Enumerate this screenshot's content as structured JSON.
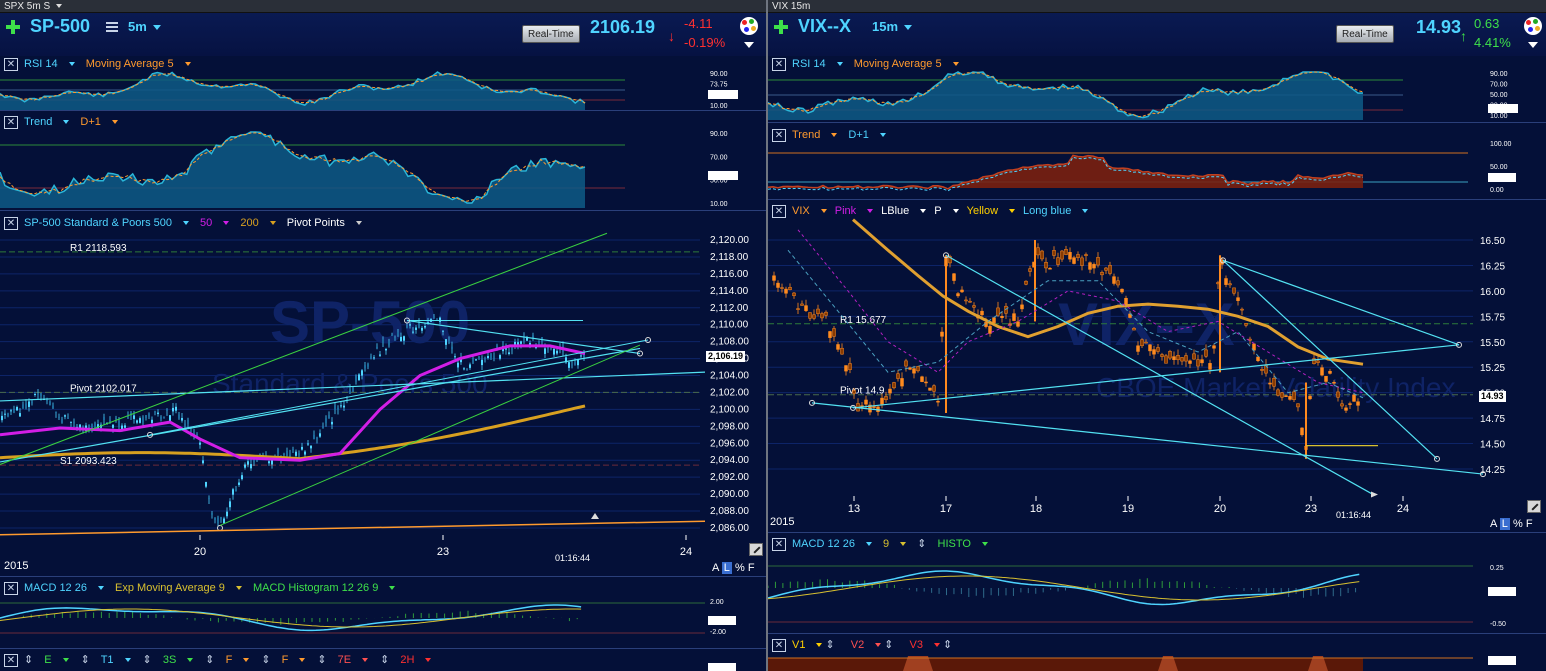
{
  "left": {
    "window_title": "SPX 5m S",
    "symbol": "SP-500",
    "interval": "5m",
    "realtime_label": "Real-Time",
    "last": "2106.19",
    "change": "-4.11",
    "change_pct": "-0.19%",
    "direction": "down",
    "rsi": {
      "name": "RSI 14",
      "ma": "Moving Average 5",
      "levels": [
        "90.00",
        "73.75",
        "50.00",
        "10.00"
      ],
      "value": "32.66"
    },
    "trend": {
      "name": "Trend",
      "param": "D+1",
      "levels": [
        "90.00",
        "70.00",
        "50.00",
        "10.00"
      ],
      "value": "37.32"
    },
    "main": {
      "title": "SP-500 Standard & Poors 500",
      "ma1": "50",
      "ma2": "200",
      "pivots": "Pivot Points",
      "watermark": "SP-500",
      "watermark_sub": "Standard & Poors 500",
      "r1_label": "R1 2118.593",
      "pivot_label": "Pivot 2102.017",
      "s1_label": "S1 2093.423",
      "y_ticks": [
        "2,120.00",
        "2,118.00",
        "2,116.00",
        "2,114.00",
        "2,112.00",
        "2,110.00",
        "2,108.00",
        "2,106.00",
        "2,104.00",
        "2,102.00",
        "2,100.00",
        "2,098.00",
        "2,096.00",
        "2,094.00",
        "2,092.00",
        "2,090.00",
        "2,088.00",
        "2,086.00"
      ],
      "price_tag": "2,106.19",
      "time_label": "01:16:44",
      "year": "2015",
      "dates": [
        "20",
        "23",
        "24"
      ]
    },
    "macd": {
      "name": "MACD 12 26",
      "ema": "Exp Moving Average 9",
      "histo": "MACD Histogram 12 26 9",
      "levels": [
        "2.00",
        "-2.00"
      ],
      "value": "-0.35"
    },
    "bottom_row": {
      "items": [
        "E",
        "T1",
        "3S",
        "F",
        "F",
        "7E",
        "2H"
      ],
      "value": "100.00"
    },
    "scale_controls": [
      "A",
      "L",
      "%",
      "F"
    ]
  },
  "right": {
    "window_title": "VIX 15m",
    "symbol": "VIX--X",
    "interval": "15m",
    "realtime_label": "Real-Time",
    "last": "14.93",
    "change": "0.63",
    "change_pct": "4.41%",
    "direction": "up",
    "rsi": {
      "name": "RSI 14",
      "ma": "Moving Average 5",
      "levels": [
        "90.00",
        "70.00",
        "50.00",
        "30.00",
        "10.00"
      ],
      "value": "20.29"
    },
    "trend": {
      "name": "Trend",
      "param": "D+1",
      "levels": [
        "100.00",
        "50.00",
        "0.00"
      ],
      "value": "29.51"
    },
    "main": {
      "legend": [
        "VIX",
        "Pink",
        "LBlue",
        "P",
        "Yellow",
        "Long blue"
      ],
      "watermark": "VIX--X",
      "watermark_sub": "CBOE Market Volatility Index",
      "r1_label": "R1 15.677",
      "pivot_label": "Pivot 14.9",
      "y_ticks": [
        "16.50",
        "16.25",
        "16.00",
        "15.75",
        "15.50",
        "15.25",
        "15.00",
        "14.75",
        "14.50",
        "14.25"
      ],
      "price_tag": "14.93",
      "time_label": "01:16:44",
      "year": "2015",
      "dates": [
        "13",
        "17",
        "18",
        "19",
        "20",
        "23",
        "24"
      ]
    },
    "macd": {
      "name": "MACD 12 26",
      "ema": "9",
      "histo": "HISTO",
      "levels": [
        "0.25",
        "-0.50"
      ],
      "value": "-0.07"
    },
    "vrow": {
      "items": [
        "V1",
        "V2",
        "V3"
      ],
      "value": "0.00"
    },
    "scale_controls": [
      "A",
      "L",
      "%",
      "F"
    ]
  },
  "colors": {
    "bg": "#041038",
    "cyan": "#4fd4ff",
    "orange": "#ff9a2e",
    "magenta": "#d21ee6",
    "gold": "#d8a020",
    "green": "#3ee04a",
    "red": "#ff3030",
    "trendline": "#53e2f2"
  }
}
